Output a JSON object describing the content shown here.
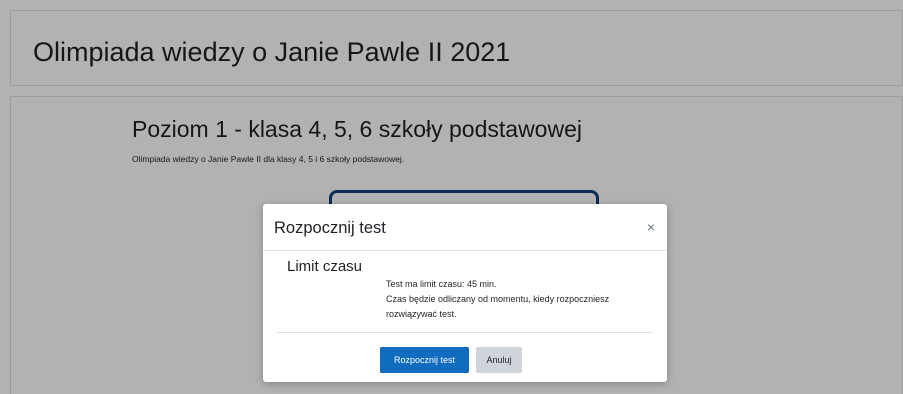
{
  "header": {
    "title": "Olimpiada wiedzy o Janie Pawle II 2021"
  },
  "main": {
    "quiz_title": "Poziom 1 - klasa 4, 5, 6 szkoły podstawowej",
    "quiz_intro": "Olimpiada wiedzy o Janie Pawle II dla klasy 4, 5 i 6 szkoły podstawowej."
  },
  "modal": {
    "title": "Rozpocznij test",
    "close_symbol": "×",
    "section_heading": "Limit czasu",
    "info_line_1": "Test ma limit czasu: 45 min.",
    "info_line_2": "Czas będzie odliczany od momentu, kiedy rozpoczniesz",
    "info_line_3": "rozwiązywać test.",
    "start_button_label": "Rozpocznij test",
    "cancel_button_label": "Anuluj"
  },
  "colors": {
    "primary_button": "#0f6cbf",
    "secondary_button": "#ced4da",
    "backdrop": "rgba(0,0,0,0.3)",
    "button_outline_behind": "#0f3e7a"
  },
  "icons": {
    "close": "close-icon"
  }
}
